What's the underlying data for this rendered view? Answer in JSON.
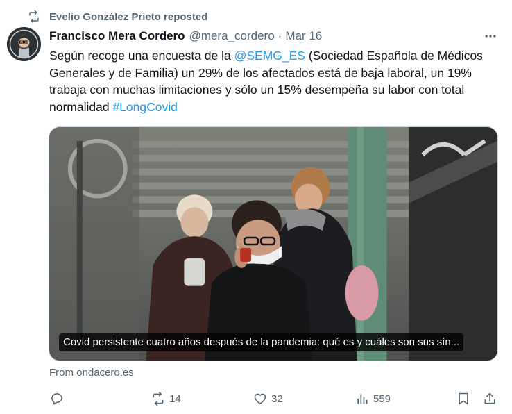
{
  "repost": {
    "text": "Evelio González Prieto reposted"
  },
  "author": {
    "name": "Francisco Mera Cordero",
    "handle": "@mera_cordero",
    "separator": "·",
    "date": "Mar 16"
  },
  "tweet": {
    "text_1": "Según recoge una encuesta de la ",
    "mention": "@SEMG_ES",
    "text_2": "  (Sociedad Española de Médicos Generales y de Familia) un 29% de los afectados está de baja laboral, un 19% trabaja con muchas limitaciones y sólo un 15% desempeña su labor con total normalidad ",
    "hashtag": "#LongCovid"
  },
  "card": {
    "caption": "Covid persistente cuatro años después de la pandemia: qué es y cuáles son sus sín...",
    "source": "From ondacero.es"
  },
  "actions": {
    "reply_count": "",
    "repost_count": "14",
    "like_count": "32",
    "view_count": "559"
  },
  "icons": {
    "repost": "repost-icon",
    "more": "more-icon",
    "reply": "reply-icon",
    "like": "heart-icon",
    "views": "views-icon",
    "bookmark": "bookmark-icon",
    "share": "share-icon"
  },
  "colors": {
    "link": "#1d9bf0",
    "secondary_text": "#536471",
    "primary_text": "#0f1419"
  }
}
